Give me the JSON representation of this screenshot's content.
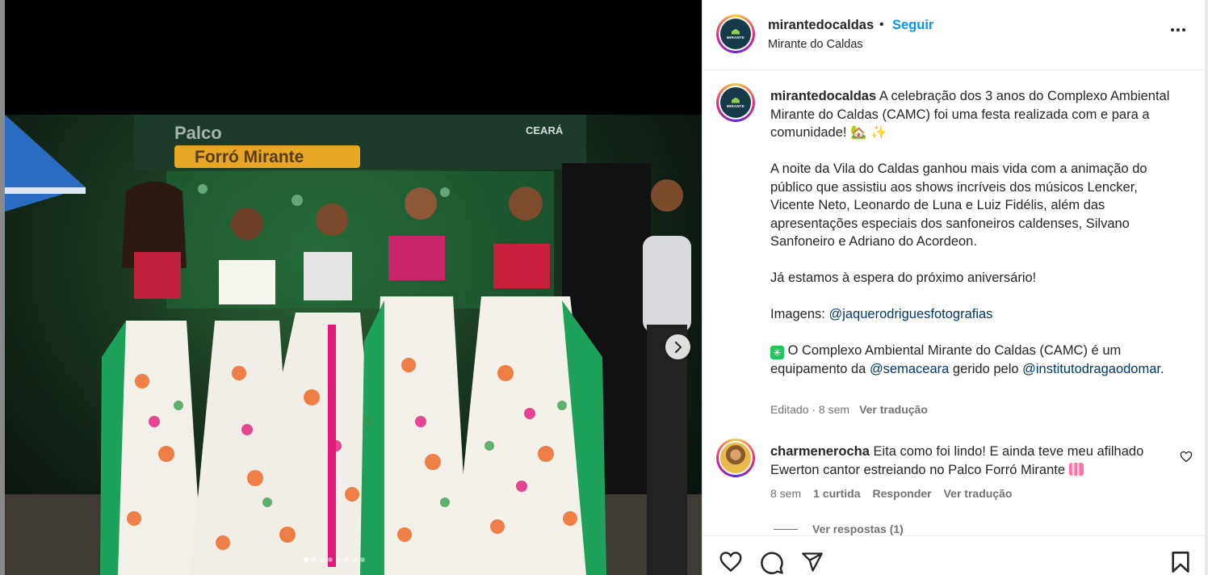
{
  "post": {
    "username": "mirantedocaldas",
    "separator": "•",
    "follow_label": "Seguir",
    "subtitle": "Mirante do Caldas",
    "avatar_brand": "MIRANTE"
  },
  "caption": {
    "username": "mirantedocaldas",
    "line1": " A celebração dos 3 anos do Complexo Ambiental Mirante do Caldas (CAMC) foi uma festa realizada com e para a comunidade! 🏡 ✨",
    "para2": "A noite da Vila do Caldas ganhou mais vida com a animação do público que assistiu aos shows incríveis dos músicos Lencker, Vicente Neto, Leonardo de Luna e Luiz Fidélis, além das apresentações especiais dos sanfoneiros caldenses, Silvano Sanfoneiro e Adriano do Acordeon.",
    "para3": "Já estamos à espera do próximo aniversário!",
    "images_prefix": "Imagens: ",
    "images_mention": "@jaquerodriguesfotografias",
    "sparkle_icon": "✳",
    "para5_a": " O Complexo Ambiental Mirante do Caldas (CAMC) é um equipamento da ",
    "para5_mention1": "@semaceara",
    "para5_b": " gerido pelo ",
    "para5_mention2": "@institutodragaodomar",
    "para5_c": ".",
    "meta": "Editado · 8 sem",
    "translate": "Ver tradução"
  },
  "comment": {
    "username": "charmenerocha",
    "text": " Eita como foi lindo! E ainda teve meu afilhado Ewerton cantor estreiando no Palco Forró Mirante ",
    "time": "8 sem",
    "likes": "1 curtida",
    "reply": "Responder",
    "translate": "Ver tradução",
    "view_replies": "Ver respostas (1)"
  },
  "media": {
    "carousel_total": 8,
    "carousel_index": 1,
    "stage_sign_title": "Palco",
    "stage_sign_subtitle": "Forró Mirante",
    "stage_sign_partner": "CEARÁ"
  },
  "icons": {
    "next": "chevron-right-icon",
    "like": "heart-icon",
    "comment": "comment-bubble-icon",
    "share": "paper-plane-icon",
    "save": "bookmark-icon",
    "more": "more-dots-icon"
  },
  "colors": {
    "follow": "#0095f6",
    "mention": "#00376b",
    "muted": "#737373",
    "text": "#262626"
  }
}
